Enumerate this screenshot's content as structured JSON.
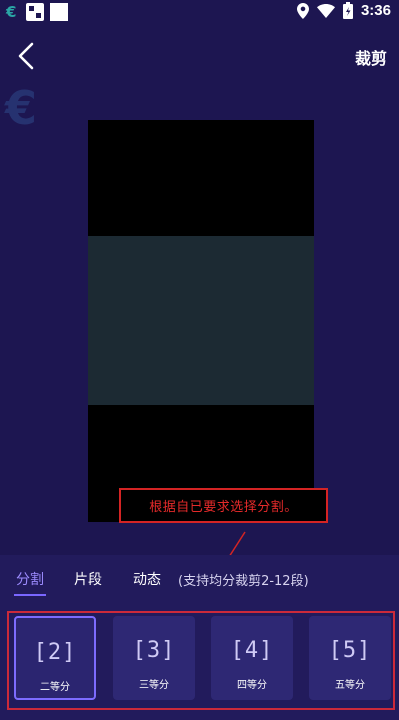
{
  "status_bar": {
    "time": "3:36",
    "icons": [
      "euro-app-icon",
      "grid-app-icon",
      "square-app-icon",
      "location-icon",
      "wifi-icon",
      "battery-icon"
    ]
  },
  "header": {
    "title": "裁剪"
  },
  "annotation": {
    "text": "根据自已要求选择分割。"
  },
  "tabs": [
    {
      "label": "分割",
      "active": true
    },
    {
      "label": "片段",
      "active": false
    },
    {
      "label": "动态",
      "active": false
    }
  ],
  "tab_hint": "(支持均分裁剪2-12段)",
  "options": [
    {
      "icon_text": "[2]",
      "label": "二等分",
      "selected": true
    },
    {
      "icon_text": "[3]",
      "label": "三等分",
      "selected": false
    },
    {
      "icon_text": "[4]",
      "label": "四等分",
      "selected": false
    },
    {
      "icon_text": "[5]",
      "label": "五等分",
      "selected": false
    }
  ],
  "colors": {
    "background": "#1d1651",
    "accent": "#7d6cff",
    "annotation_red": "#d42424"
  }
}
